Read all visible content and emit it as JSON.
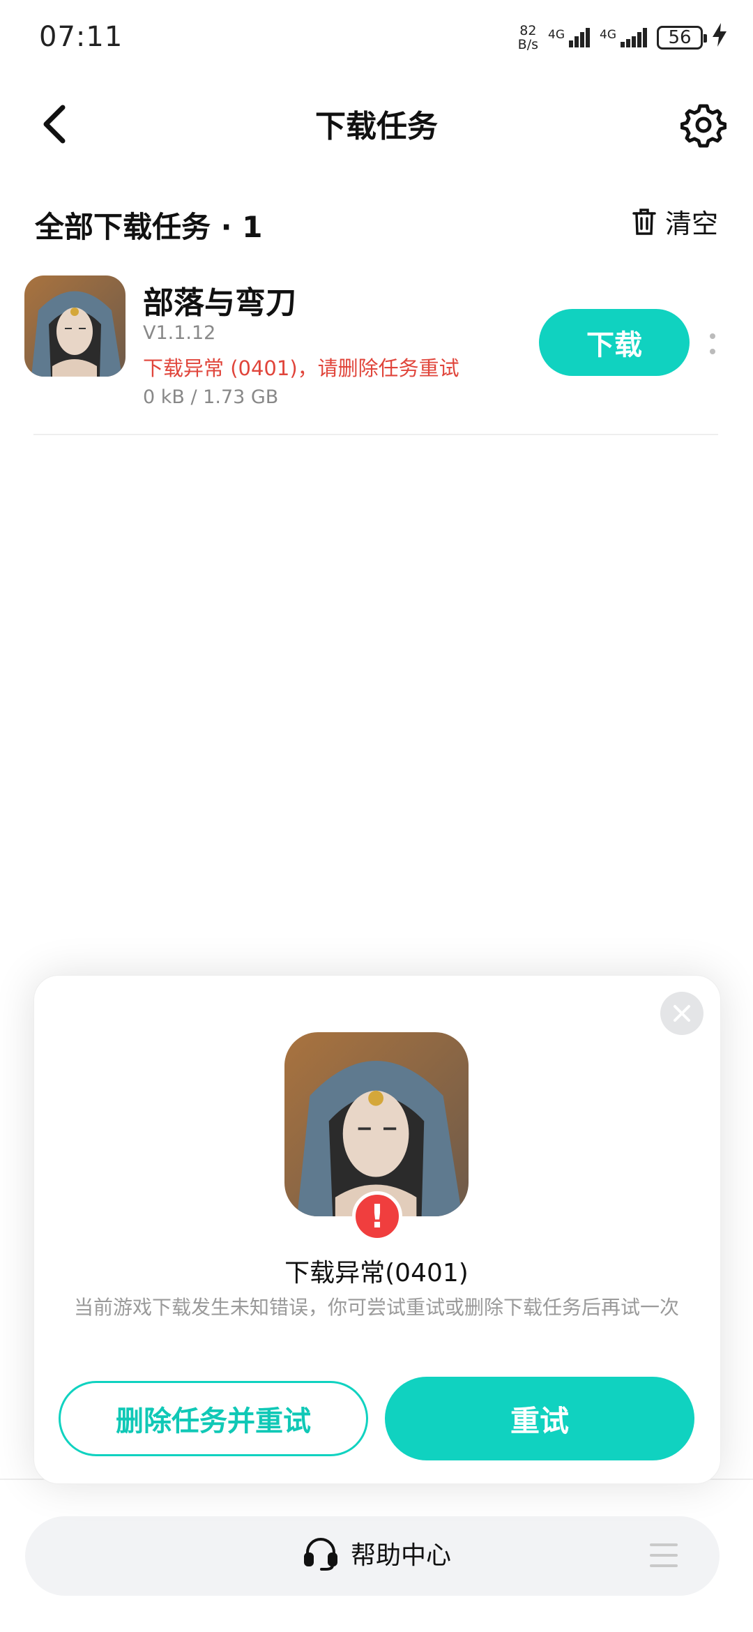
{
  "status_bar": {
    "time": "07:11",
    "speed_value": "82",
    "speed_unit": "B/s",
    "signal1_label": "4G",
    "signal2_label": "4G",
    "battery": "56"
  },
  "header": {
    "title": "下载任务",
    "back_icon": "chevron-left-icon",
    "settings_icon": "gear-icon"
  },
  "list": {
    "heading": "全部下载任务 · 1",
    "clear_label": "清空",
    "clear_icon": "trash-icon"
  },
  "item": {
    "name": "部落与弯刀",
    "version": "V1.1.12",
    "error": "下载异常 (0401)，请删除任务重试",
    "size": "0 kB / 1.73 GB",
    "action_label": "下载"
  },
  "dialog": {
    "title": "下载异常(0401)",
    "description": "当前游戏下载发生未知错误，你可尝试重试或删除下载任务后再试一次",
    "secondary_label": "删除任务并重试",
    "primary_label": "重试",
    "alert_glyph": "!"
  },
  "help": {
    "label": "帮助中心",
    "icon": "headset-icon"
  },
  "colors": {
    "accent": "#10d2c0",
    "error": "#e0453b"
  }
}
